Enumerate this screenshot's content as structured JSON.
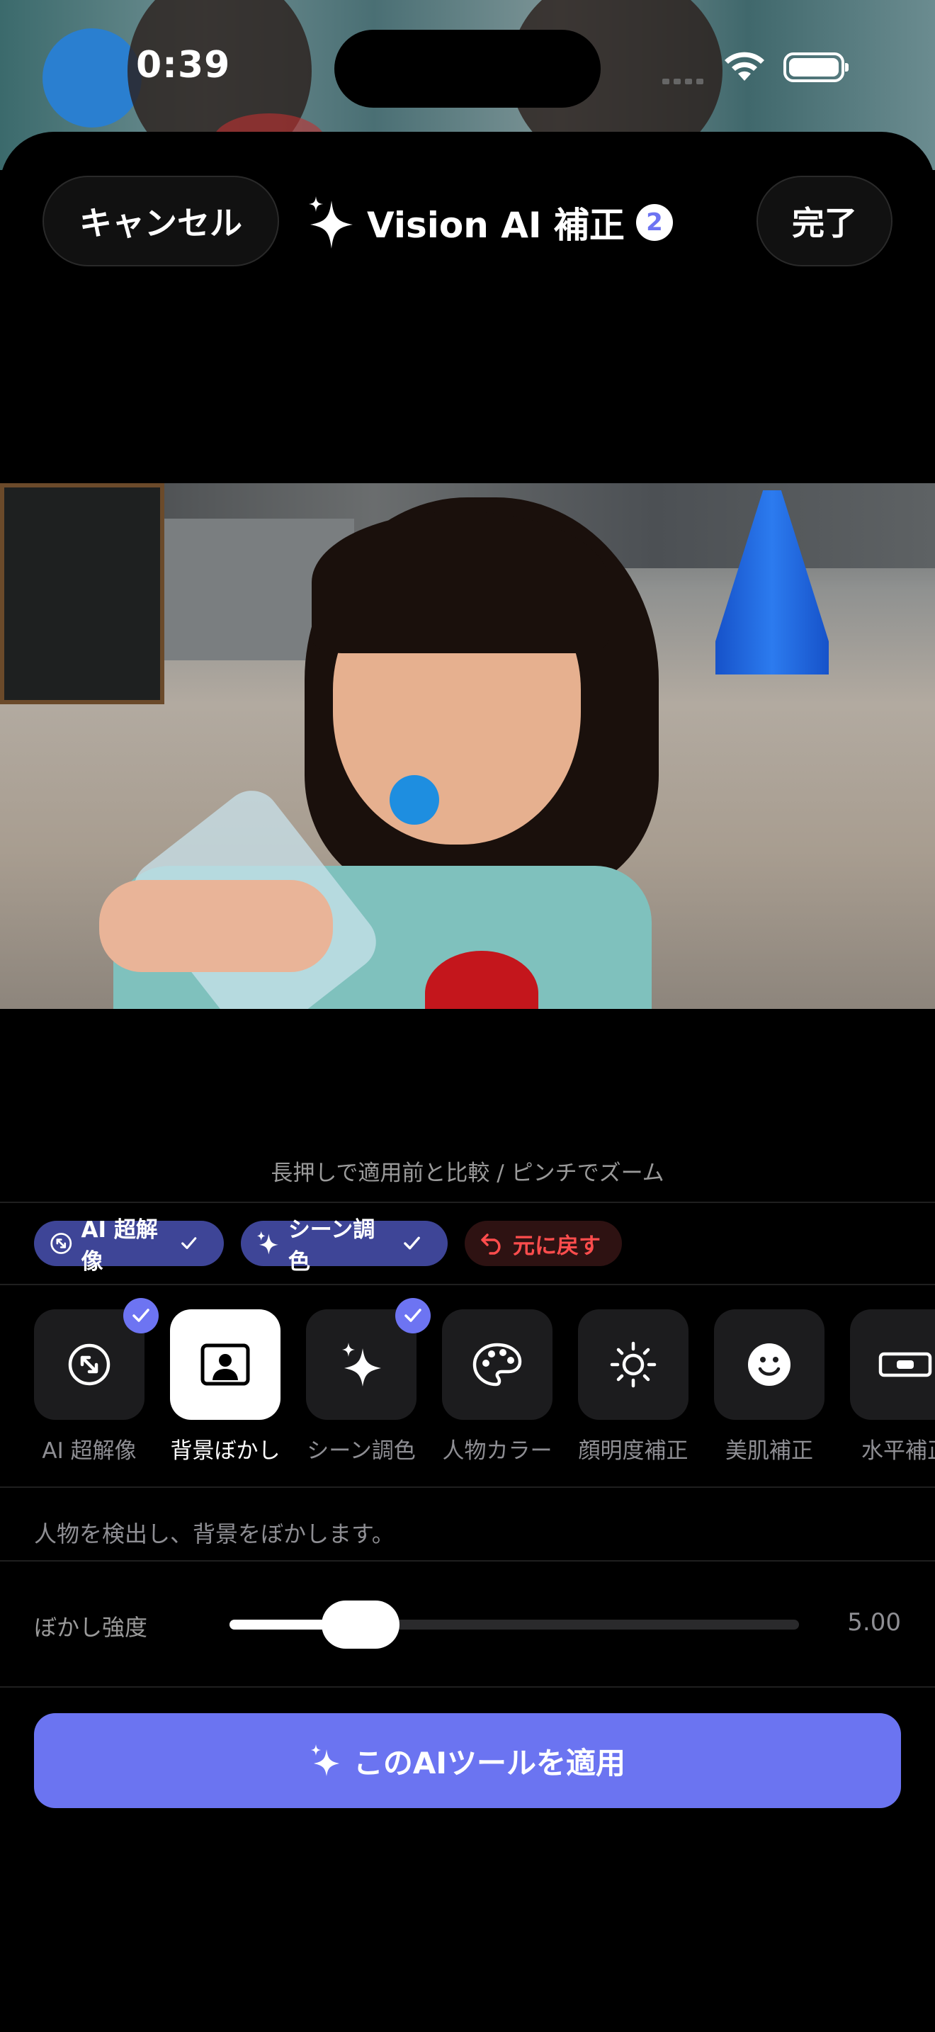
{
  "status_bar": {
    "time": "0:39"
  },
  "header": {
    "cancel_label": "キャンセル",
    "title": "Vision AI 補正",
    "badge_count": "2",
    "done_label": "完了"
  },
  "photo": {
    "icon": "photo-preview"
  },
  "hint": "長押しで適用前と比較 / ピンチでズーム",
  "chips": [
    {
      "label": "AI 超解像",
      "icon": "upscale-icon",
      "checked": true
    },
    {
      "label": "シーン調色",
      "icon": "sparkle-icon",
      "checked": true
    },
    {
      "label": "元に戻す",
      "icon": "undo-icon"
    }
  ],
  "tools": [
    {
      "label": "AI 超解像",
      "icon": "upscale-icon",
      "applied": true
    },
    {
      "label": "背景ぼかし",
      "icon": "portrait-icon",
      "selected": true
    },
    {
      "label": "シーン調色",
      "icon": "sparkle-icon",
      "applied": true
    },
    {
      "label": "人物カラー",
      "icon": "palette-icon"
    },
    {
      "label": "顔明度補正",
      "icon": "sun-icon"
    },
    {
      "label": "美肌補正",
      "icon": "smiley-icon"
    },
    {
      "label": "水平補正",
      "icon": "level-icon"
    }
  ],
  "description": "人物を検出し、背景をぼかします。",
  "slider": {
    "label": "ぼかし強度",
    "value": "5.00",
    "fraction": 0.23
  },
  "apply_label": "このAIツールを適用",
  "colors": {
    "accent": "#6b74f1",
    "chip_blue": "#3e4597",
    "danger": "#ff4d4d"
  }
}
